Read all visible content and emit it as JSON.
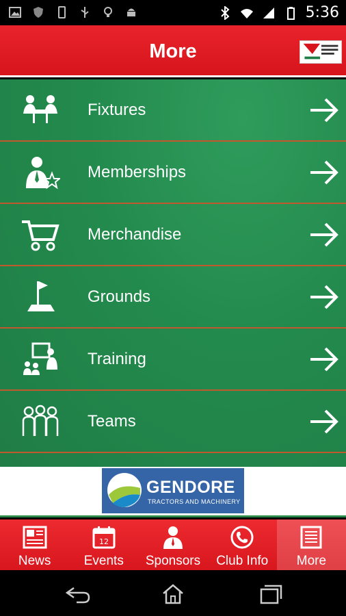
{
  "status_bar": {
    "time": "5:36",
    "left_icons": [
      "image-icon",
      "shield-icon",
      "phone-icon",
      "usb-icon",
      "bulb-icon",
      "android-icon"
    ],
    "right_icons": [
      "bluetooth-icon",
      "wifi-icon",
      "signal-icon",
      "battery-icon"
    ]
  },
  "header": {
    "title": "More",
    "logo_text": "Sponsored Club"
  },
  "menu": {
    "items": [
      {
        "label": "Fixtures",
        "icon": "fixtures-icon"
      },
      {
        "label": "Memberships",
        "icon": "membership-icon"
      },
      {
        "label": "Merchandise",
        "icon": "cart-icon"
      },
      {
        "label": "Grounds",
        "icon": "flag-icon"
      },
      {
        "label": "Training",
        "icon": "training-icon"
      },
      {
        "label": "Teams",
        "icon": "teams-icon"
      }
    ]
  },
  "banner": {
    "title": "GENDORE",
    "subtitle": "TRACTORS AND MACHINERY"
  },
  "tabs": [
    {
      "label": "News",
      "icon": "news-icon",
      "active": false
    },
    {
      "label": "Events",
      "icon": "calendar-icon",
      "active": false,
      "badge": "12"
    },
    {
      "label": "Sponsors",
      "icon": "person-icon",
      "active": false
    },
    {
      "label": "Club Info",
      "icon": "phone-icon",
      "active": false
    },
    {
      "label": "More",
      "icon": "list-icon",
      "active": true
    }
  ],
  "colors": {
    "header_red": "#e3202a",
    "list_green": "#238a4d",
    "divider": "#c2582e",
    "ad_blue": "#3565a6"
  }
}
